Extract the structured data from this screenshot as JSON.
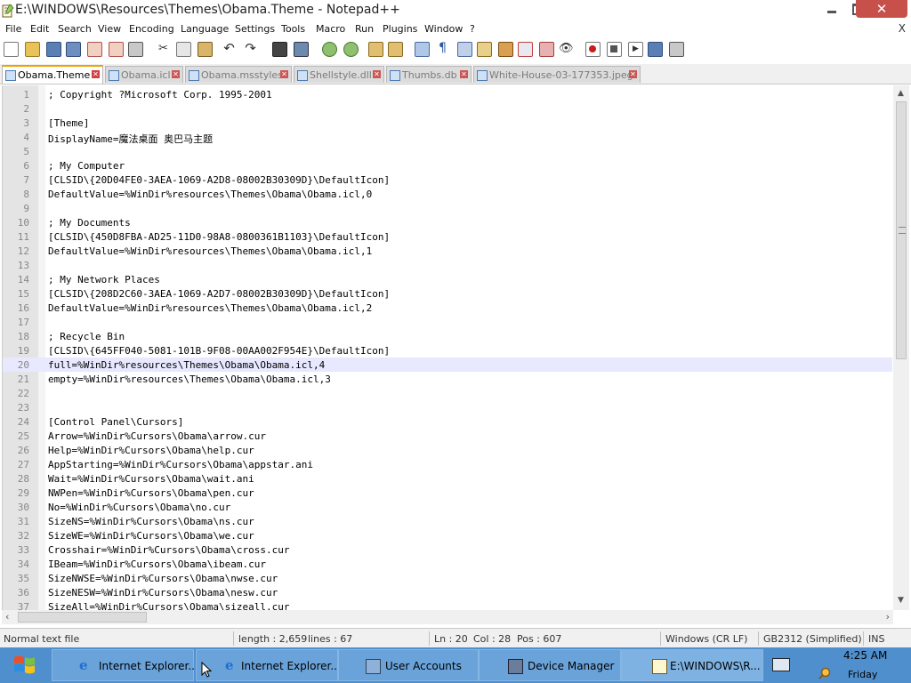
{
  "window": {
    "title": "E:\\WINDOWS\\Resources\\Themes\\Obama.Theme - Notepad++"
  },
  "menu": {
    "items": [
      "File",
      "Edit",
      "Search",
      "View",
      "Encoding",
      "Language",
      "Settings",
      "Tools",
      "Macro",
      "Run",
      "Plugins",
      "Window",
      "?"
    ],
    "close_label": "X"
  },
  "toolbar": {
    "icons": [
      "new-file-icon",
      "open-file-icon",
      "save-icon",
      "save-all-icon",
      "close-icon",
      "close-all-icon",
      "print-icon",
      "cut-icon",
      "copy-icon",
      "paste-icon",
      "undo-icon",
      "redo-icon",
      "find-icon",
      "replace-icon",
      "zoom-in-icon",
      "zoom-out-icon",
      "sync-vertical-icon",
      "sync-horizontal-icon",
      "word-wrap-icon",
      "show-all-characters-icon",
      "indent-guide-icon",
      "user-defined-language-icon",
      "document-map-icon",
      "function-list-icon",
      "folder-workspace-icon",
      "monitoring-icon",
      "record-macro-icon",
      "stop-recording-icon",
      "playback-macro-icon",
      "run-macro-multiple-icon",
      "save-macro-icon"
    ]
  },
  "tabs": [
    {
      "label": "Obama.Theme",
      "active": true
    },
    {
      "label": "Obama.icl",
      "active": false
    },
    {
      "label": "Obama.msstyles",
      "active": false
    },
    {
      "label": "Shellstyle.dll",
      "active": false
    },
    {
      "label": "Thumbs.db",
      "active": false
    },
    {
      "label": "White-House-03-177353.jpeg",
      "active": false
    }
  ],
  "editor": {
    "current_line": 20,
    "lines": [
      {
        "n": "1",
        "text": "; Copyright ?Microsoft Corp. 1995-2001"
      },
      {
        "n": "2",
        "text": ""
      },
      {
        "n": "3",
        "text": "[Theme]"
      },
      {
        "n": "4",
        "text": "DisplayName=魔法桌面 奥巴马主题"
      },
      {
        "n": "5",
        "text": ""
      },
      {
        "n": "6",
        "text": "; My Computer"
      },
      {
        "n": "7",
        "text": "[CLSID\\{20D04FE0-3AEA-1069-A2D8-08002B30309D}\\DefaultIcon]"
      },
      {
        "n": "8",
        "text": "DefaultValue=%WinDir%resources\\Themes\\Obama\\Obama.icl,0"
      },
      {
        "n": "9",
        "text": ""
      },
      {
        "n": "10",
        "text": "; My Documents"
      },
      {
        "n": "11",
        "text": "[CLSID\\{450D8FBA-AD25-11D0-98A8-0800361B1103}\\DefaultIcon]"
      },
      {
        "n": "12",
        "text": "DefaultValue=%WinDir%resources\\Themes\\Obama\\Obama.icl,1"
      },
      {
        "n": "13",
        "text": ""
      },
      {
        "n": "14",
        "text": "; My Network Places"
      },
      {
        "n": "15",
        "text": "[CLSID\\{208D2C60-3AEA-1069-A2D7-08002B30309D}\\DefaultIcon]"
      },
      {
        "n": "16",
        "text": "DefaultValue=%WinDir%resources\\Themes\\Obama\\Obama.icl,2"
      },
      {
        "n": "17",
        "text": ""
      },
      {
        "n": "18",
        "text": "; Recycle Bin"
      },
      {
        "n": "19",
        "text": "[CLSID\\{645FF040-5081-101B-9F08-00AA002F954E}\\DefaultIcon]"
      },
      {
        "n": "20",
        "text": "full=%WinDir%resources\\Themes\\Obama\\Obama.icl,4"
      },
      {
        "n": "21",
        "text": "empty=%WinDir%resources\\Themes\\Obama\\Obama.icl,3"
      },
      {
        "n": "22",
        "text": ""
      },
      {
        "n": "23",
        "text": ""
      },
      {
        "n": "24",
        "text": "[Control Panel\\Cursors]"
      },
      {
        "n": "25",
        "text": "Arrow=%WinDir%Cursors\\Obama\\arrow.cur"
      },
      {
        "n": "26",
        "text": "Help=%WinDir%Cursors\\Obama\\help.cur"
      },
      {
        "n": "27",
        "text": "AppStarting=%WinDir%Cursors\\Obama\\appstar.ani"
      },
      {
        "n": "28",
        "text": "Wait=%WinDir%Cursors\\Obama\\wait.ani"
      },
      {
        "n": "29",
        "text": "NWPen=%WinDir%Cursors\\Obama\\pen.cur"
      },
      {
        "n": "30",
        "text": "No=%WinDir%Cursors\\Obama\\no.cur"
      },
      {
        "n": "31",
        "text": "SizeNS=%WinDir%Cursors\\Obama\\ns.cur"
      },
      {
        "n": "32",
        "text": "SizeWE=%WinDir%Cursors\\Obama\\we.cur"
      },
      {
        "n": "33",
        "text": "Crosshair=%WinDir%Cursors\\Obama\\cross.cur"
      },
      {
        "n": "34",
        "text": "IBeam=%WinDir%Cursors\\Obama\\ibeam.cur"
      },
      {
        "n": "35",
        "text": "SizeNWSE=%WinDir%Cursors\\Obama\\nwse.cur"
      },
      {
        "n": "36",
        "text": "SizeNESW=%WinDir%Cursors\\Obama\\nesw.cur"
      },
      {
        "n": "37",
        "text": "SizeAll=%WinDir%Cursors\\Obama\\sizeall.cur"
      }
    ]
  },
  "statusbar": {
    "file_type": "Normal text file",
    "length": "length : 2,659",
    "lines": "lines : 67",
    "ln": "Ln : 20",
    "col": "Col : 28",
    "pos": "Pos : 607",
    "eol": "Windows (CR LF)",
    "encoding": "GB2312 (Simplified)",
    "mode": "INS"
  },
  "taskbar": {
    "tasks": [
      {
        "label": "Internet Explorer...",
        "icon": "internet-explorer-icon"
      },
      {
        "label": "Internet Explorer...",
        "icon": "internet-explorer-icon"
      },
      {
        "label": "User Accounts",
        "icon": "user-accounts-icon"
      },
      {
        "label": "Device Manager",
        "icon": "device-manager-icon"
      },
      {
        "label": "E:\\WINDOWS\\R...",
        "icon": "notepad-plus-plus-icon"
      }
    ],
    "clock_time": "4:25 AM",
    "clock_day": "Friday"
  }
}
